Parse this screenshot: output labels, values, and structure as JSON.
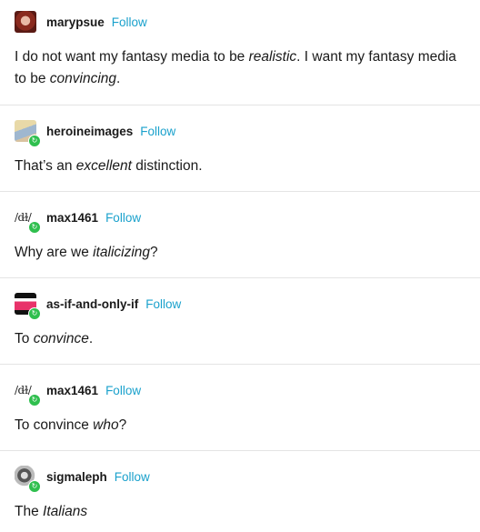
{
  "follow_label": "Follow",
  "posts": [
    {
      "username": "marypsue",
      "avatar": "red-hair-portrait",
      "segments": [
        {
          "t": "I do not want my fantasy media to be ",
          "i": false
        },
        {
          "t": "realistic",
          "i": true
        },
        {
          "t": ". I want my fantasy media to be ",
          "i": false
        },
        {
          "t": "convincing",
          "i": true
        },
        {
          "t": ".",
          "i": false
        }
      ]
    },
    {
      "username": "heroineimages",
      "avatar": "illustrated-portrait",
      "segments": [
        {
          "t": "That’s an ",
          "i": false
        },
        {
          "t": "excellent",
          "i": true
        },
        {
          "t": " distinction.",
          "i": false
        }
      ]
    },
    {
      "username": "max1461",
      "avatar": "text-glyph",
      "avatar_text": "/d̵ɫ/",
      "segments": [
        {
          "t": "Why are we ",
          "i": false
        },
        {
          "t": "italicizing",
          "i": true
        },
        {
          "t": "?",
          "i": false
        }
      ]
    },
    {
      "username": "as-if-and-only-if",
      "avatar": "pink-stripe",
      "segments": [
        {
          "t": "To ",
          "i": false
        },
        {
          "t": "convince",
          "i": true
        },
        {
          "t": ".",
          "i": false
        }
      ]
    },
    {
      "username": "max1461",
      "avatar": "text-glyph",
      "avatar_text": "/d̵ɫ/",
      "segments": [
        {
          "t": "To convince ",
          "i": false
        },
        {
          "t": "who",
          "i": true
        },
        {
          "t": "?",
          "i": false
        }
      ]
    },
    {
      "username": "sigmaleph",
      "avatar": "bw-sketch",
      "segments": [
        {
          "t": "The ",
          "i": false
        },
        {
          "t": "Italians",
          "i": true
        }
      ]
    }
  ],
  "colors": {
    "follow": "#1aa1cc",
    "badge": "#2fbf4e",
    "divider": "#e4e4e4"
  }
}
